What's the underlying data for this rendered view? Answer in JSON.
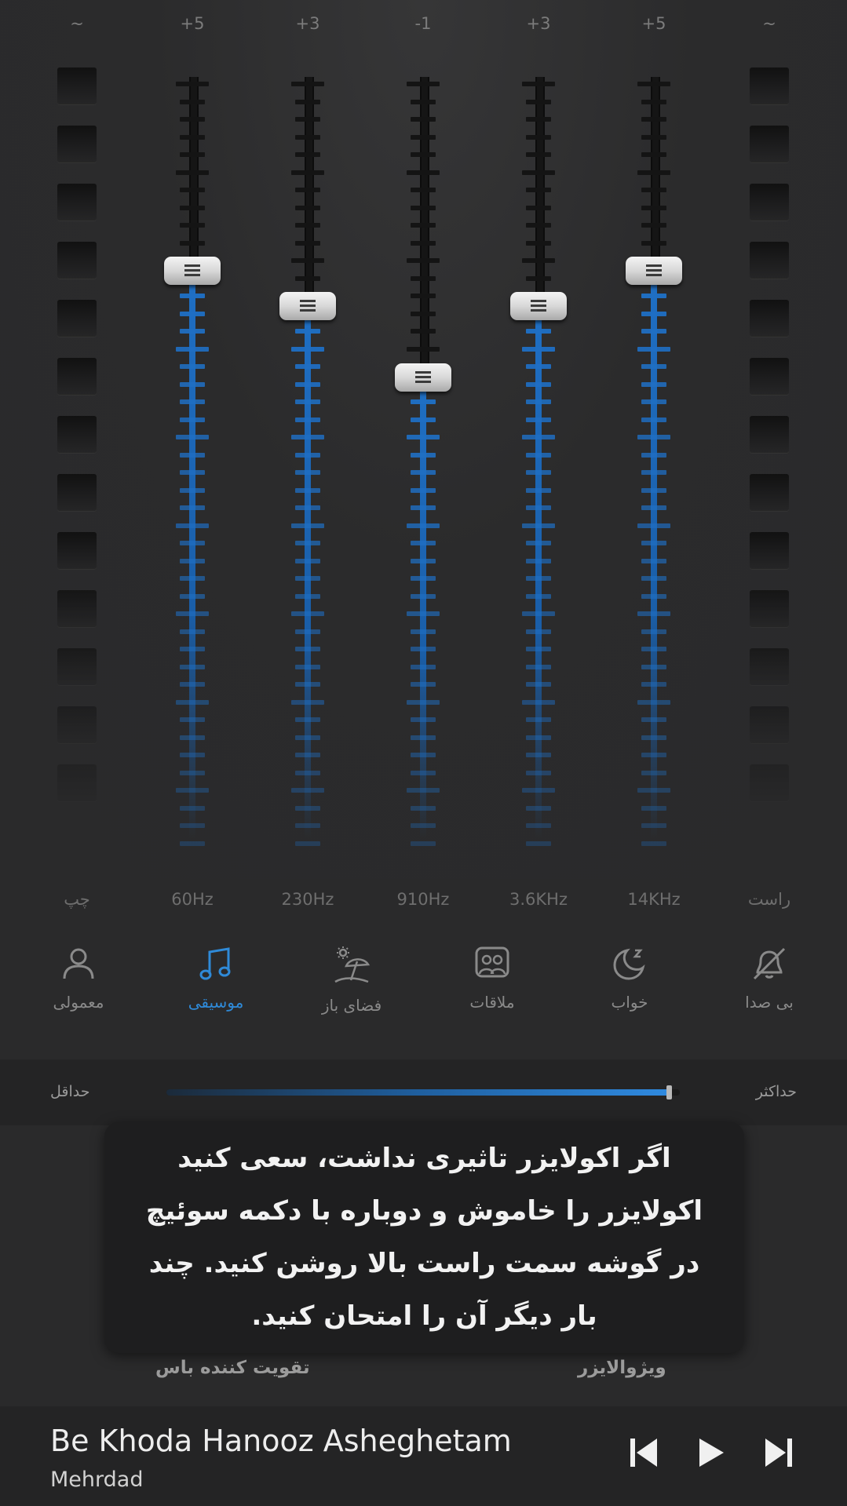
{
  "equalizer": {
    "left_meter_label": "~",
    "right_meter_label": "~",
    "left_channel_label": "چپ",
    "right_channel_label": "راست",
    "bands": [
      {
        "freq": "60Hz",
        "gain_label": "+5",
        "gain": 5
      },
      {
        "freq": "230Hz",
        "gain_label": "+3",
        "gain": 3
      },
      {
        "freq": "910Hz",
        "gain_label": "-1",
        "gain": -1
      },
      {
        "freq": "3.6KHz",
        "gain_label": "+3",
        "gain": 3
      },
      {
        "freq": "14KHz",
        "gain_label": "+5",
        "gain": 5
      }
    ],
    "gain_range": [
      -15,
      15
    ],
    "fill_color": "#1f6fc4",
    "rail_color": "#151515"
  },
  "presets": {
    "items": [
      {
        "label": "معمولی",
        "icon": "person-icon",
        "active": false
      },
      {
        "label": "موسیقی",
        "icon": "music-note-icon",
        "active": true
      },
      {
        "label": "فضای باز",
        "icon": "beach-umbrella-icon",
        "active": false
      },
      {
        "label": "ملاقات",
        "icon": "meeting-icon",
        "active": false
      },
      {
        "label": "خواب",
        "icon": "moon-icon",
        "active": false
      },
      {
        "label": "بی صدا",
        "icon": "mute-icon",
        "active": false
      }
    ],
    "active_color": "#2f8ad8",
    "inactive_color": "#8a8a8a"
  },
  "strength": {
    "min_label": "حداقل",
    "max_label": "حداکثر",
    "value": 0.98
  },
  "toast": {
    "message": "اگر اکولایزر تاثیری نداشت، سعی کنید اکولایزر را خاموش و دوباره با دکمه سوئیچ در گوشه سمت راست بالا روشن کنید. چند بار دیگر آن را امتحان کنید."
  },
  "sub_labels": {
    "bass_boost": "تقویت کننده باس",
    "visualizer": "ویژوالایزر"
  },
  "player": {
    "title": "Be Khoda Hanooz Asheghetam",
    "artist": "Mehrdad",
    "prev_icon": "skip-previous-icon",
    "play_icon": "play-icon",
    "next_icon": "skip-next-icon"
  }
}
